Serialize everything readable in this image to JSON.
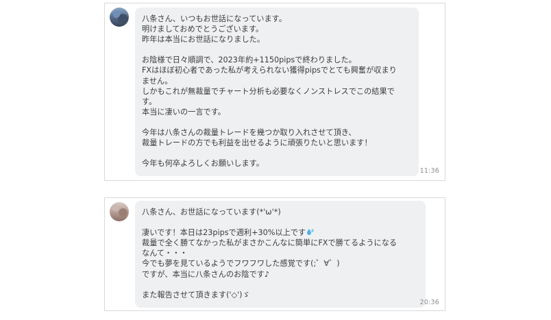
{
  "messages": [
    {
      "time": "11:36",
      "lines": [
        "八条さん、いつもお世話になっています。",
        "明けましておめでとうございます。",
        "昨年は本当にお世話になりました。",
        "",
        "お陰様で日々順調で、2023年約+1150pipsで終わりました。",
        "FXはほぼ初心者であった私が考えられない獲得pipsでとても興奮が収まり",
        "ません。",
        "しかもこれが無裁量でチャート分析も必要なくノンストレスでこの結果で",
        "す。",
        "本当に凄いの一言です。",
        "",
        "今年は八条さんの裁量トレードを幾つか取り入れさせて頂き、",
        "裁量トレードの方でも利益を出せるように頑張りたいと思います！",
        "",
        "今年も何卒よろしくお願いします。"
      ]
    },
    {
      "time": "20:36",
      "lines": [
        "八条さん、お世話になっています(*'ω'*)",
        "",
        "凄いです！本日は23pipsで週利+30%以上です",
        "裁量で全く勝てなかった私がまさかこんなに簡単にFXで勝てるようになる",
        "なんて・・・",
        "今でも夢を見ているようでフワフワした感覚です(;゜∀゜)",
        "ですが、本当に八条さんのお陰です♪",
        "",
        "また報告させて頂きます('◇')ゞ"
      ]
    }
  ],
  "icons": {
    "emoji_after_line_3_msg2": "sweat-droplets-icon"
  }
}
